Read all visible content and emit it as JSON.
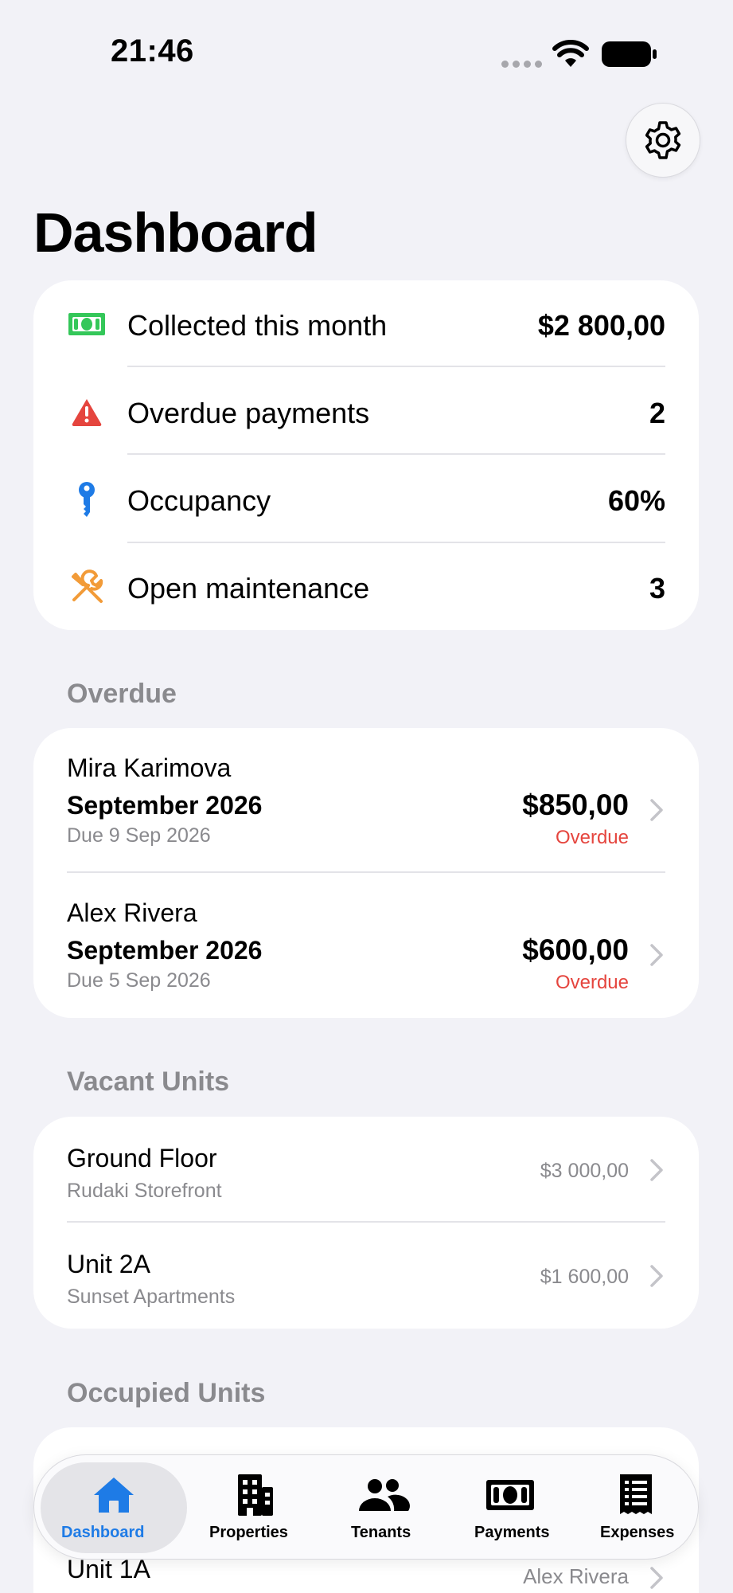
{
  "status_bar": {
    "time": "21:46"
  },
  "page": {
    "title": "Dashboard"
  },
  "summary": [
    {
      "icon": "banknote-icon",
      "label": "Collected this month",
      "value": "$2 800,00",
      "color": "#34C759"
    },
    {
      "icon": "warning-icon",
      "label": "Overdue payments",
      "value": "2",
      "color": "#E5453E"
    },
    {
      "icon": "key-icon",
      "label": "Occupancy",
      "value": "60%",
      "color": "#1E7BE6"
    },
    {
      "icon": "wrench-screwdriver-icon",
      "label": "Open maintenance",
      "value": "3",
      "color": "#F29B38"
    }
  ],
  "overdue": {
    "header": "Overdue",
    "items": [
      {
        "tenant": "Mira Karimova",
        "period": "September 2026",
        "due": "Due 9 Sep 2026",
        "amount": "$850,00",
        "status": "Overdue"
      },
      {
        "tenant": "Alex Rivera",
        "period": "September 2026",
        "due": "Due 5 Sep 2026",
        "amount": "$600,00",
        "status": "Overdue"
      }
    ]
  },
  "vacant": {
    "header": "Vacant Units",
    "items": [
      {
        "name": "Ground Floor",
        "property": "Rudaki Storefront",
        "rent": "$3 000,00"
      },
      {
        "name": "Unit 2A",
        "property": "Sunset Apartments",
        "rent": "$1 600,00"
      }
    ]
  },
  "occupied": {
    "header": "Occupied Units",
    "items": [
      {
        "name": "Unit 1A",
        "tenant": "Alex Rivera"
      }
    ]
  },
  "tabs": [
    {
      "label": "Dashboard",
      "icon": "house-icon",
      "active": true
    },
    {
      "label": "Properties",
      "icon": "building-icon",
      "active": false
    },
    {
      "label": "Tenants",
      "icon": "people-icon",
      "active": false
    },
    {
      "label": "Payments",
      "icon": "banknote-icon",
      "active": false
    },
    {
      "label": "Expenses",
      "icon": "receipt-icon",
      "active": false
    }
  ],
  "colors": {
    "accent": "#1E7BE6",
    "overdue": "#E5453E",
    "background": "#F2F2F7"
  }
}
